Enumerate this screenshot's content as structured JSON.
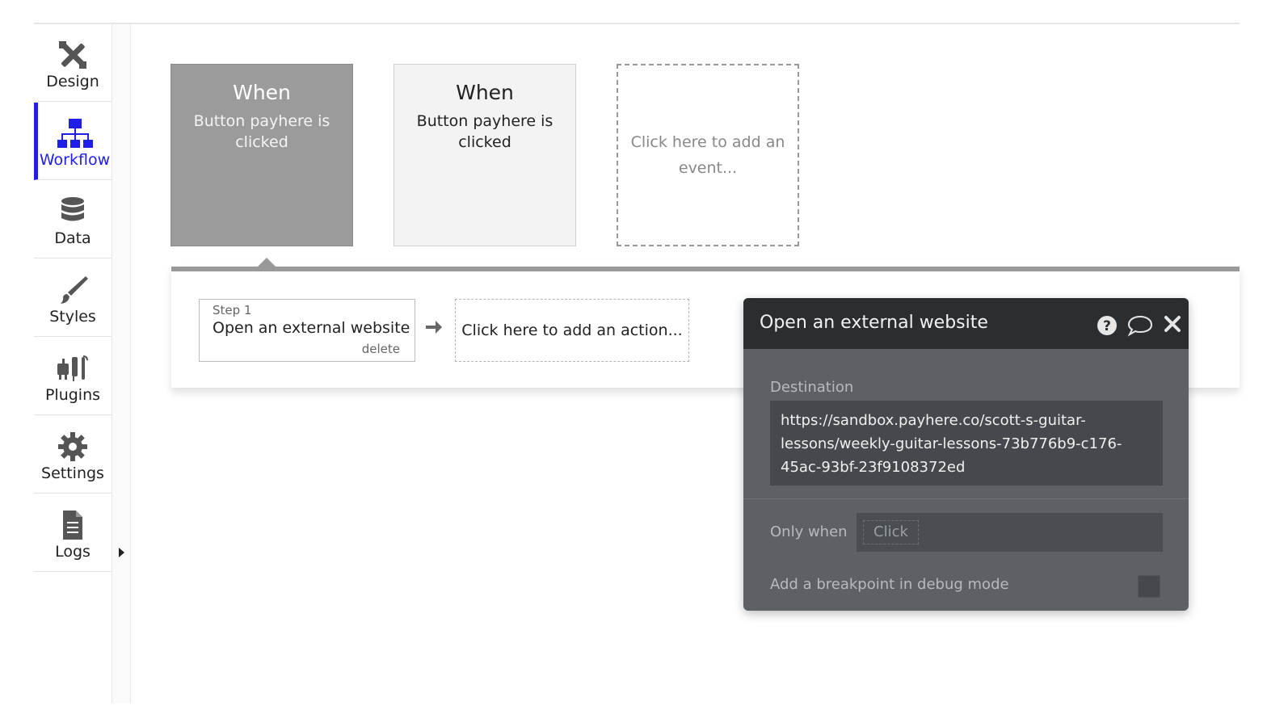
{
  "sidebar": {
    "items": [
      {
        "label": "Design",
        "icon": "design-icon"
      },
      {
        "label": "Workflow",
        "icon": "workflow-icon",
        "active": true
      },
      {
        "label": "Data",
        "icon": "database-icon"
      },
      {
        "label": "Styles",
        "icon": "brush-icon"
      },
      {
        "label": "Plugins",
        "icon": "plug-icon"
      },
      {
        "label": "Settings",
        "icon": "gear-icon"
      },
      {
        "label": "Logs",
        "icon": "document-icon"
      }
    ]
  },
  "events": [
    {
      "when": "When",
      "description": "Button payhere is clicked",
      "selected": true
    },
    {
      "when": "When",
      "description": "Button payhere is clicked",
      "selected": false
    }
  ],
  "add_event": "Click here to add an event...",
  "actions": {
    "step": {
      "number": "Step 1",
      "title": "Open an external website",
      "delete": "delete"
    },
    "add_action": "Click here to add an action..."
  },
  "panel": {
    "title": "Open an external website",
    "destination_label": "Destination",
    "destination_value": "https://sandbox.payhere.co/scott-s-guitar-lessons/weekly-guitar-lessons-73b776b9-c176-45ac-93bf-23f9108372ed",
    "only_when_label": "Only when",
    "only_when_placeholder": "Click",
    "breakpoint_label": "Add a breakpoint in debug mode",
    "breakpoint_checked": false
  },
  "colors": {
    "accent": "#1e1ee8",
    "panel_bg": "#5d6165",
    "panel_header": "#2b2e31",
    "selected_card": "#9b9b9b"
  }
}
